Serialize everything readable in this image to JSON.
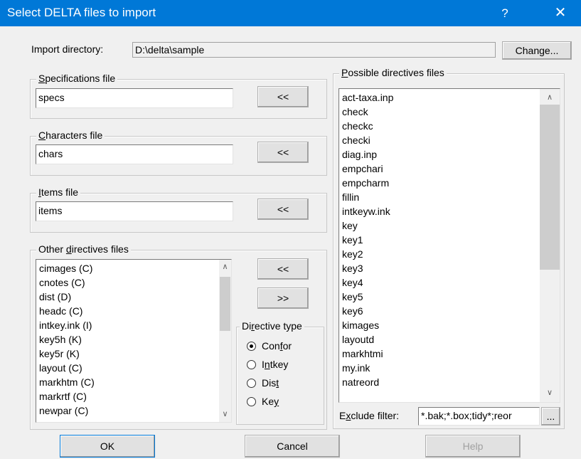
{
  "window": {
    "title": "Select DELTA files to import",
    "help_glyph": "?",
    "close_glyph": "✕"
  },
  "import_directory": {
    "label": "Import directory:",
    "value": "D:\\delta\\sample",
    "change_label": "Change..."
  },
  "specifications": {
    "legend_pre": "",
    "legend_u": "S",
    "legend_post": "pecifications file",
    "value": "specs",
    "move_label": "<<"
  },
  "characters": {
    "legend_pre": "",
    "legend_u": "C",
    "legend_post": "haracters file",
    "value": "chars",
    "move_label": "<<"
  },
  "items": {
    "legend_pre": "",
    "legend_u": "I",
    "legend_post": "tems file",
    "value": "items",
    "move_label": "<<"
  },
  "other_directives": {
    "legend_pre": "Other ",
    "legend_u": "d",
    "legend_post": "irectives files",
    "items": [
      "cimages (C)",
      "cnotes (C)",
      "dist (D)",
      "headc (C)",
      "intkey.ink (I)",
      "key5h (K)",
      "key5r (K)",
      "layout (C)",
      "markhtm (C)",
      "markrtf (C)",
      "newpar (C)"
    ],
    "move_left_label": "<<",
    "move_right_label": ">>"
  },
  "directive_type": {
    "legend_pre": "Di",
    "legend_u": "r",
    "legend_post": "ective type",
    "options": [
      {
        "pre": "Con",
        "u": "f",
        "post": "or",
        "checked": true
      },
      {
        "pre": "I",
        "u": "n",
        "post": "tkey",
        "checked": false
      },
      {
        "pre": "Dis",
        "u": "t",
        "post": "",
        "checked": false
      },
      {
        "pre": "Ke",
        "u": "y",
        "post": "",
        "checked": false
      }
    ]
  },
  "possible_directives": {
    "legend_pre": "",
    "legend_u": "P",
    "legend_post": "ossible directives files",
    "items": [
      "act-taxa.inp",
      "check",
      "checkc",
      "checki",
      "diag.inp",
      "empchari",
      "empcharm",
      "fillin",
      "intkeyw.ink",
      "key",
      "key1",
      "key2",
      "key3",
      "key4",
      "key5",
      "key6",
      "kimages",
      "layoutd",
      "markhtmi",
      "my.ink",
      "natreord"
    ]
  },
  "exclude_filter": {
    "label_pre": "E",
    "label_u": "x",
    "label_post": "clude filter:",
    "value": "*.bak;*.box;tidy*;reor",
    "browse_label": "..."
  },
  "buttons": {
    "ok": "OK",
    "cancel": "Cancel",
    "help": "Help"
  },
  "scroll": {
    "up_glyph": "∧",
    "down_glyph": "∨"
  },
  "colors": {
    "titlebar": "#0078d7",
    "dialog_bg": "#f0f0f0"
  }
}
